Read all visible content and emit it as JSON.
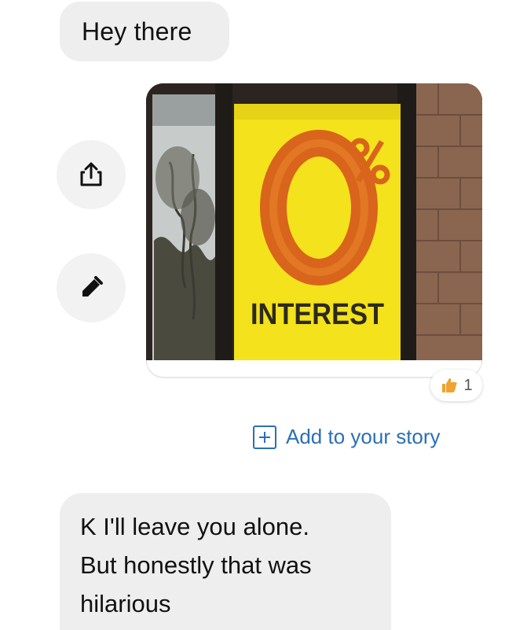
{
  "messages": {
    "first": {
      "text": "Hey there"
    },
    "image": {
      "sign_text": "INTEREST",
      "sign_zero": "0",
      "sign_percent": "%"
    },
    "reaction": {
      "icon": "thumbs-up-icon",
      "count": "1"
    },
    "story": {
      "label": "Add to your story",
      "icon": "plus-box-icon"
    },
    "reply": {
      "lines": [
        "K I'll leave you alone.",
        "But honestly that was",
        "hilarious"
      ]
    }
  },
  "actions": {
    "share_icon": "share-icon",
    "edit_icon": "pencil-icon"
  },
  "colors": {
    "bubble": "#eeeeef",
    "link": "#2b6fb5",
    "sign_yellow": "#f3e21c",
    "sign_orange": "#d9641c",
    "reaction": "#f0a232"
  }
}
